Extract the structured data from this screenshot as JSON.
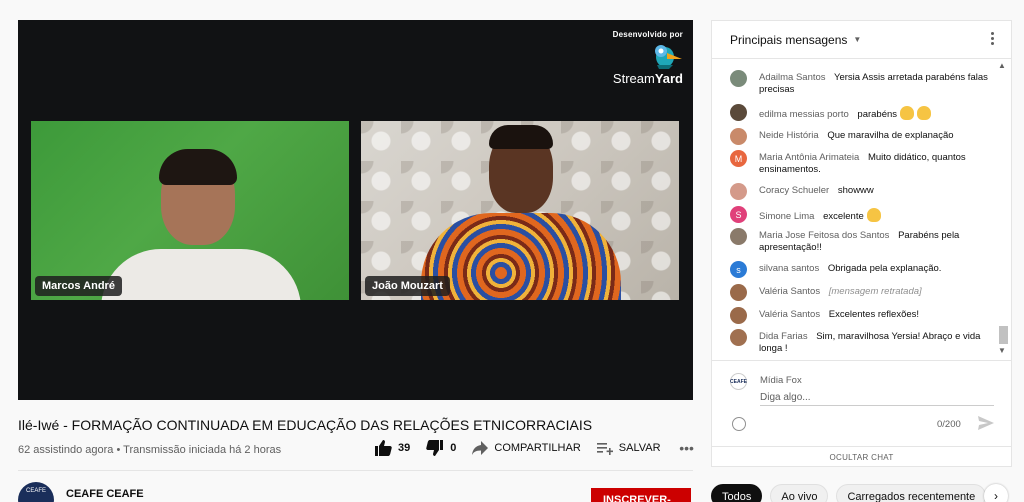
{
  "brand": {
    "developed_by": "Desenvolvido por",
    "name_part1": "Stream",
    "name_part2": "Yard"
  },
  "cameras": [
    {
      "name": "Marcos André"
    },
    {
      "name": "João Mouzart"
    }
  ],
  "video": {
    "title": "Ilé-Iwé - FORMAÇÃO CONTINUADA EM EDUCAÇÃO DAS RELAÇÕES ETNICORRACIAIS",
    "meta": "62 assistindo agora • Transmissão iniciada há 2 horas",
    "likes": "39",
    "dislikes": "0",
    "share_label": "COMPARTILHAR",
    "save_label": "SALVAR"
  },
  "channel": {
    "name": "CEAFE CEAFE",
    "avatar_text": "CEAFE",
    "subscribe_label": "INSCREVER-SE"
  },
  "chat": {
    "header": "Principais mensagens",
    "messages": [
      {
        "author": "Adailma Santos",
        "text": "Yersia Assis arretada parabéns falas precisas",
        "avatar_color": "#7a8b7a"
      },
      {
        "author": "edilma messias porto",
        "text": "parabéns",
        "avatar_color": "#5b4a3a"
      },
      {
        "author": "Neide História",
        "text": "Que maravilha de explanação",
        "avatar_color": "#c98a6a"
      },
      {
        "author": "Maria Antônia Arimateia",
        "text": "Muito didático, quantos ensinamentos.",
        "avatar_letter": "M",
        "avatar_color": "#e8673f"
      },
      {
        "author": "Coracy Schueler",
        "text": "showww",
        "avatar_color": "#d49a8a"
      },
      {
        "author": "Simone Lima",
        "text": "excelente",
        "avatar_letter": "S",
        "avatar_color": "#e0407a"
      },
      {
        "author": "Maria Jose Feitosa dos Santos",
        "text": "Parabéns pela apresentação!!",
        "avatar_color": "#8a7a6a"
      },
      {
        "author": "silvana santos",
        "text": "Obrigada pela explanação.",
        "avatar_letter": "s",
        "avatar_color": "#2b7bd6"
      },
      {
        "author": "Valéria Santos",
        "text": "[mensagem retratada]",
        "avatar_color": "#9a6a4a"
      },
      {
        "author": "Valéria Santos",
        "text": "Excelentes reflexões!",
        "avatar_color": "#9a6a4a"
      },
      {
        "author": "Dida Farias",
        "text": "Sim, maravilhosa Yersia! Abraço e vida longa !",
        "avatar_color": "#a07050"
      }
    ],
    "me_name": "Mídia Fox",
    "me_avatar": "CEAFE",
    "input_placeholder": "Diga algo...",
    "counter": "0/200",
    "hide_label": "OCULTAR CHAT"
  },
  "chips": [
    "Todos",
    "Ao vivo",
    "Carregados recentemente"
  ],
  "colors": {
    "accent_red": "#cc0000",
    "player_bg": "#111214"
  }
}
